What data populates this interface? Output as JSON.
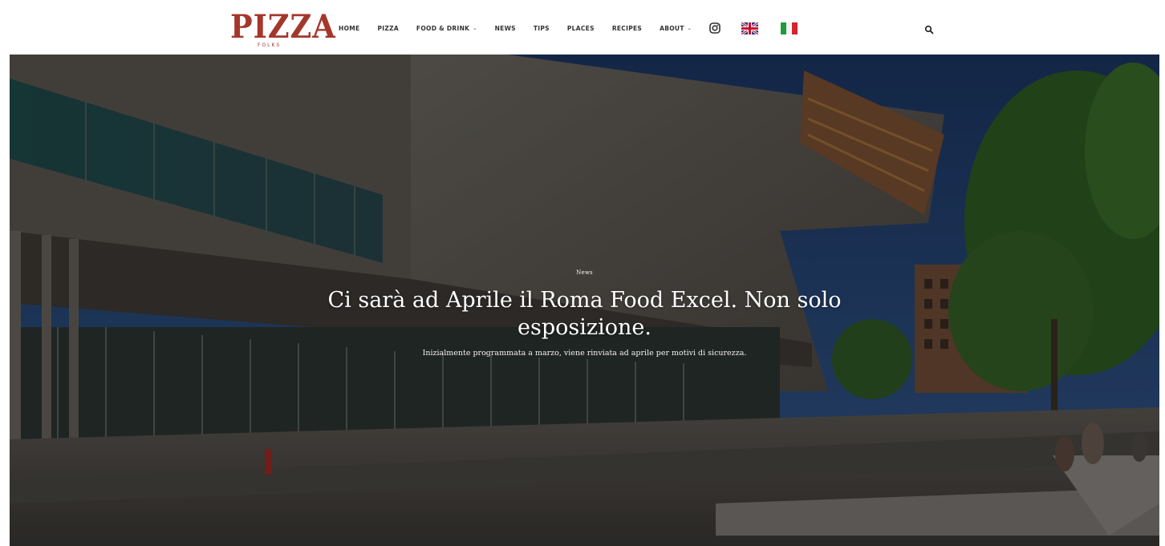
{
  "header": {
    "logo_text": "PIZZA",
    "logo_subtext": "FOLKS",
    "nav": [
      {
        "label": "HOME",
        "has_dropdown": false
      },
      {
        "label": "PIZZA",
        "has_dropdown": false
      },
      {
        "label": "FOOD & DRINK",
        "has_dropdown": true
      },
      {
        "label": "NEWS",
        "has_dropdown": false
      },
      {
        "label": "TIPS",
        "has_dropdown": false
      },
      {
        "label": "PLACES",
        "has_dropdown": false
      },
      {
        "label": "RECIPES",
        "has_dropdown": false
      },
      {
        "label": "ABOUT",
        "has_dropdown": true
      }
    ],
    "dropdown_caret": "⌄",
    "icons": [
      "instagram-icon",
      "uk-flag-icon",
      "italy-flag-icon",
      "search-icon"
    ]
  },
  "hero": {
    "category": "News",
    "title": "Ci sarà ad Aprile il Roma Food Excel. Non solo esposizione.",
    "excerpt": "Inizialmente programmata a marzo, viene rinviata ad aprile per motivi di sicurezza."
  },
  "colors": {
    "brand": "#a4372c",
    "nav_text": "#333333",
    "hero_text": "#ffffff",
    "sky": "#1e3a68"
  }
}
